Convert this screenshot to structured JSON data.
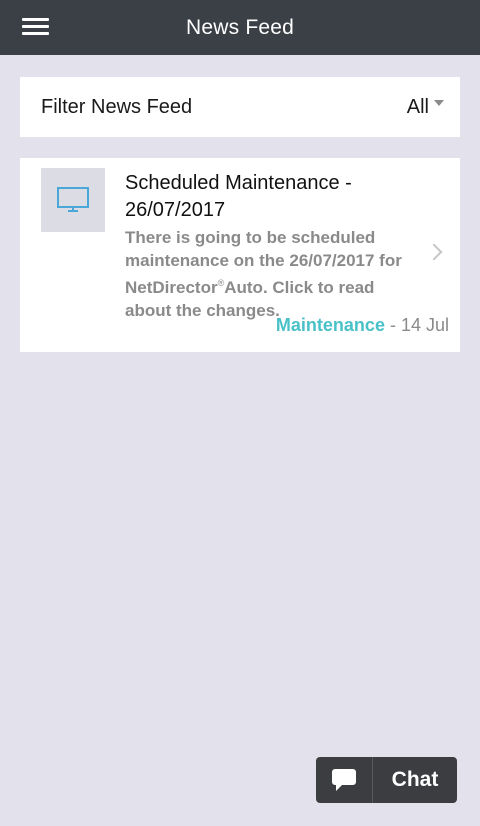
{
  "header": {
    "title": "News Feed"
  },
  "filter": {
    "label": "Filter News Feed",
    "value": "All"
  },
  "news_items": [
    {
      "icon": "monitor-icon",
      "title": "Scheduled Maintenance - 26/07/2017",
      "body_before": "There is going to be scheduled maintenance on the 26/07/2017 for NetDirector",
      "body_mark": "®",
      "body_after": "Auto. Click to read about the changes.",
      "category": "Maintenance",
      "separator": " - ",
      "date": "14 Jul"
    }
  ],
  "chat": {
    "label": "Chat"
  },
  "colors": {
    "header_bg": "#3b4047",
    "page_bg": "#e3e2ec",
    "accent": "#49c1c8",
    "chat_bg": "#3b3d40"
  }
}
